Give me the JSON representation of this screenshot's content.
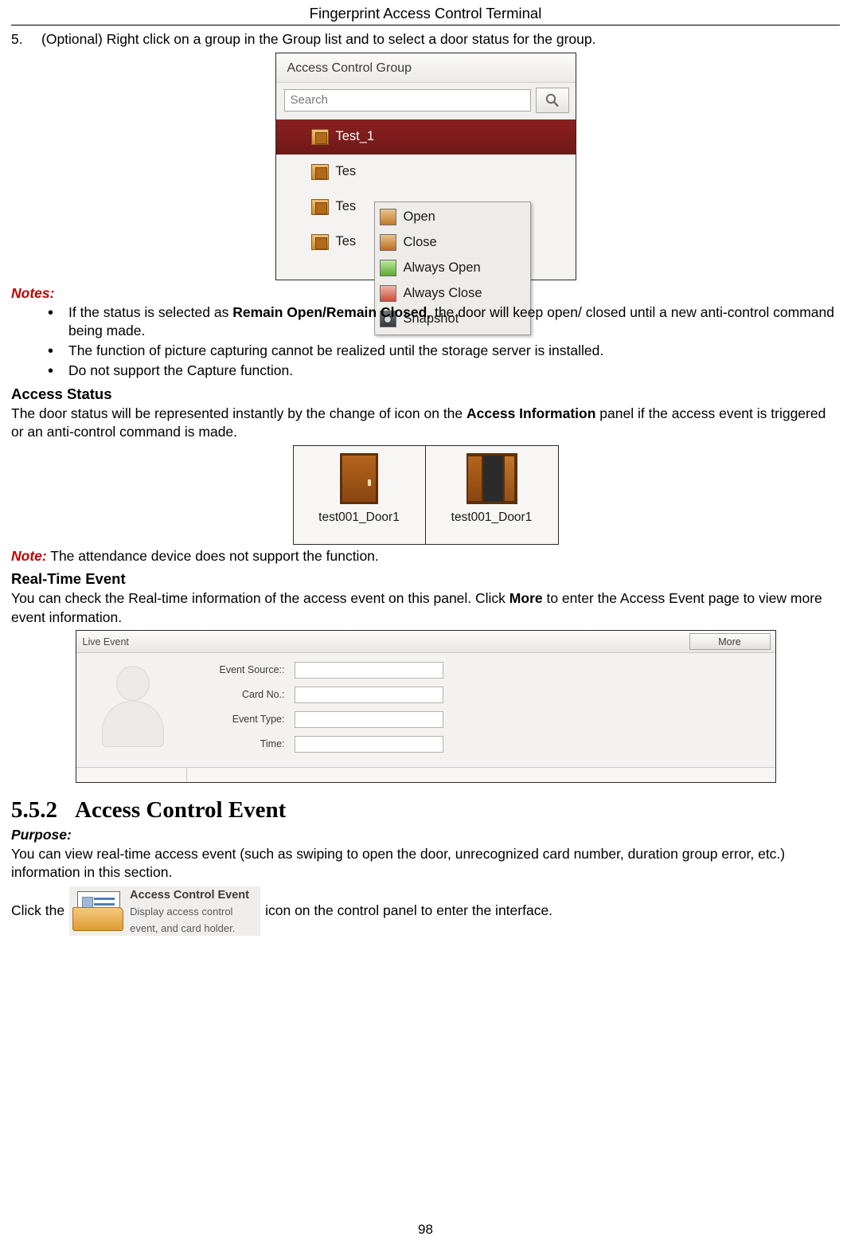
{
  "header": {
    "title": "Fingerprint Access Control Terminal"
  },
  "step5": {
    "number": "5.",
    "text": "(Optional) Right click on a group in the Group list and to select a door status for the group."
  },
  "access_control_group": {
    "title": "Access Control Group",
    "search_placeholder": "Search",
    "search_icon": "magnifier-icon",
    "rows": [
      {
        "label": "Test_1"
      },
      {
        "label": "Tes"
      },
      {
        "label": "Tes"
      },
      {
        "label": "Tes"
      }
    ],
    "context_menu": [
      {
        "label": "Open",
        "icon": "door-open-icon"
      },
      {
        "label": "Close",
        "icon": "door-close-icon"
      },
      {
        "label": "Always Open",
        "icon": "always-open-icon"
      },
      {
        "label": "Always Close",
        "icon": "always-close-icon"
      },
      {
        "label": "Snapshot",
        "icon": "camera-icon"
      }
    ]
  },
  "notes": {
    "heading": "Notes:",
    "items": [
      {
        "part1": "If the status is selected as ",
        "bold": "Remain Open/Remain Closed",
        "part2": ", the door will keep open/ closed until a new anti-control command being made."
      },
      {
        "part1": "The function of picture capturing cannot be realized until the storage server is installed.",
        "bold": "",
        "part2": ""
      },
      {
        "part1": "Do not support the Capture function.",
        "bold": "",
        "part2": ""
      }
    ]
  },
  "access_status": {
    "heading": "Access Status",
    "para_part1": "The door status will be represented instantly by the change of icon on the ",
    "para_bold": "Access Information",
    "para_part2": " panel if the access event is triggered or an anti-control command is made.",
    "doors": [
      {
        "label": "test001_Door1",
        "state": "closed"
      },
      {
        "label": "test001_Door1",
        "state": "open"
      }
    ],
    "note_label": "Note:",
    "note_text": " The attendance device does not support the function."
  },
  "real_time_event": {
    "heading": "Real-Time Event",
    "para_part1": "You can check the Real-time information of the access event on this panel. Click ",
    "para_bold": "More",
    "para_part2": " to enter the Access Event page to view more event information.",
    "panel": {
      "title": "Live Event",
      "more_label": "More",
      "avatar": "person-placeholder-icon",
      "fields": [
        {
          "label": "Event Source::",
          "value": ""
        },
        {
          "label": "Card No.:",
          "value": ""
        },
        {
          "label": "Event Type:",
          "value": ""
        },
        {
          "label": "Time:",
          "value": ""
        }
      ]
    }
  },
  "section552": {
    "number": "5.5.2",
    "title": "Access Control Event",
    "purpose_label": "Purpose:",
    "purpose_text": "You can view real-time access event (such as swiping to open the door, unrecognized card number, duration group error, etc.) information in this section.",
    "click_prefix": "Click the",
    "icon": {
      "title": "Access Control Event",
      "line1": "Display access control",
      "line2": "event, and card holder."
    },
    "click_suffix": "icon on the control panel to enter the interface."
  },
  "footer": {
    "page_number": "98"
  }
}
